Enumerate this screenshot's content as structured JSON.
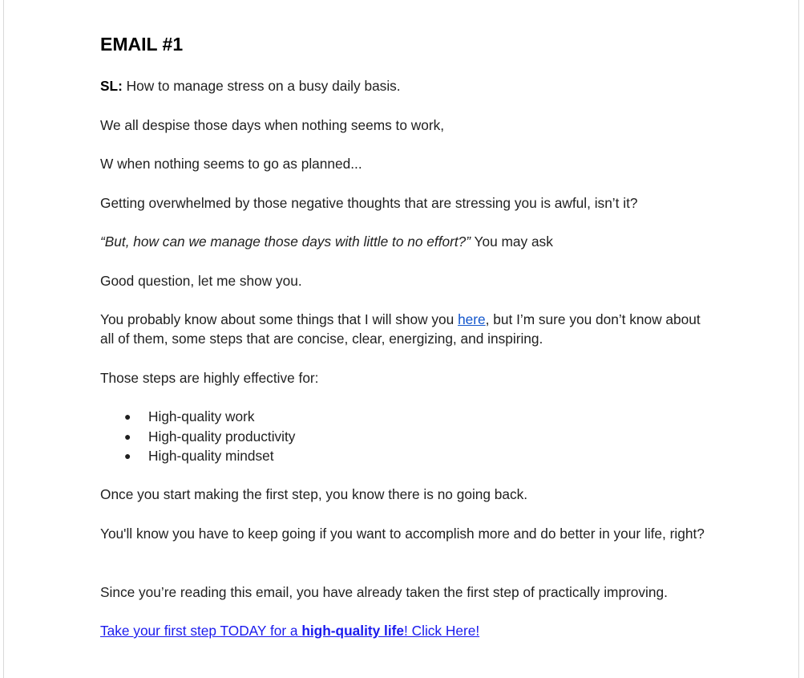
{
  "email": {
    "title": "EMAIL #1",
    "subject_label": "SL:",
    "subject_text": " How to manage stress on a busy daily basis.",
    "line1": "We all despise those days when nothing seems to work,",
    "line2": "W when nothing seems to go as planned...",
    "line3": "Getting overwhelmed by those negative thoughts that are stressing you is awful, isn’t it?",
    "quote_italic": "“But, how can we manage those days with little to no effort?”",
    "quote_rest": " You may ask",
    "line5": "Good question, let me show you.",
    "line6_before": "You probably  know about some things that I will show you ",
    "line6_link": "here",
    "line6_after": ", but I’m sure you don’t know about all of them, some steps that are concise, clear, energizing, and inspiring.",
    "line7": "Those steps are highly effective for:",
    "bullet_glyph": "●",
    "bullets": [
      "High-quality work",
      "High-quality productivity",
      "High-quality mindset"
    ],
    "line8": "Once you start making the first step, you know there is no going back.",
    "line9": "You'll know you have to keep going if you want to accomplish more and do better in your life, right?",
    "line10": "Since you’re reading this email, you have already taken the first step of practically improving.",
    "cta_before": "Take your first step TODAY for a ",
    "cta_bold": "high-quality life",
    "cta_after": "! Click Here!",
    "colors": {
      "text": "#1f1f1f",
      "link": "#1155cc",
      "cta_link": "#1a1aee"
    }
  }
}
